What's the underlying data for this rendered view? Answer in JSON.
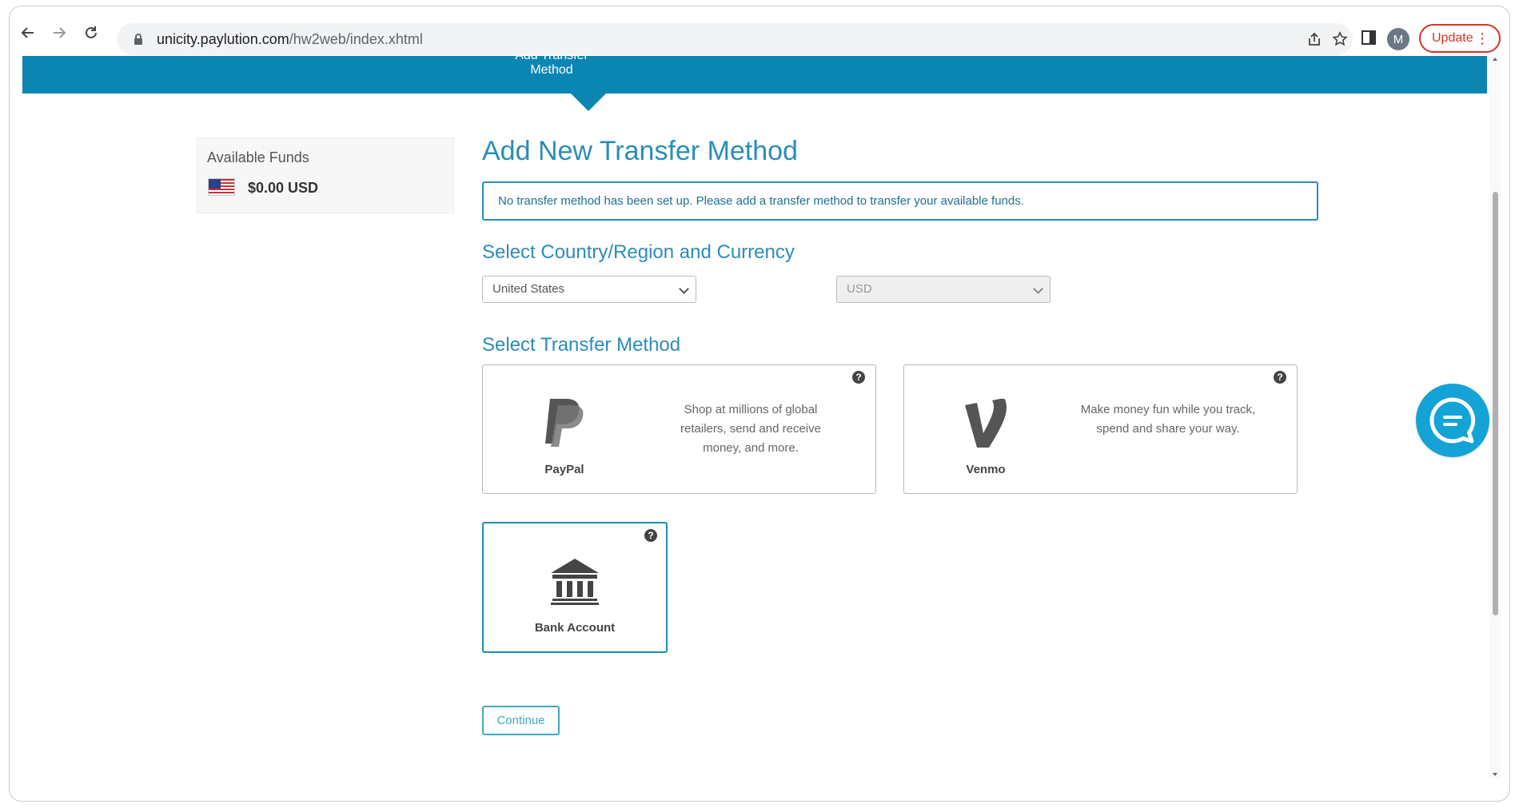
{
  "browser": {
    "url_host": "unicity.paylution.com",
    "url_path": "/hw2web/index.xhtml",
    "avatar_letter": "M",
    "update_label": "Update"
  },
  "banner": {
    "step_text_cut": "Add Transfer",
    "step_text": "Method",
    "color": "#0b86b3"
  },
  "funds": {
    "label": "Available Funds",
    "amount": "$0.00 USD",
    "flag_icon": "us-flag-icon"
  },
  "page": {
    "title": "Add New Transfer Method",
    "notice": "No transfer method has been set up. Please add a transfer method to transfer your available funds."
  },
  "country_section": {
    "title": "Select Country/Region and Currency",
    "country_value": "United States",
    "currency_value": "USD"
  },
  "method_section": {
    "title": "Select Transfer Method",
    "methods": [
      {
        "label": "PayPal",
        "description": "Shop at millions of global retailers, send and receive money, and more.",
        "icon": "paypal-logo-icon"
      },
      {
        "label": "Venmo",
        "description": "Make money fun while you track, spend and share your way.",
        "icon": "venmo-logo-icon"
      },
      {
        "label": "Bank Account",
        "description": "",
        "icon": "bank-icon"
      }
    ],
    "help_glyph": "?"
  },
  "actions": {
    "continue_label": "Continue"
  },
  "colors": {
    "accent": "#2a8db8",
    "chat": "#14a3d6"
  }
}
